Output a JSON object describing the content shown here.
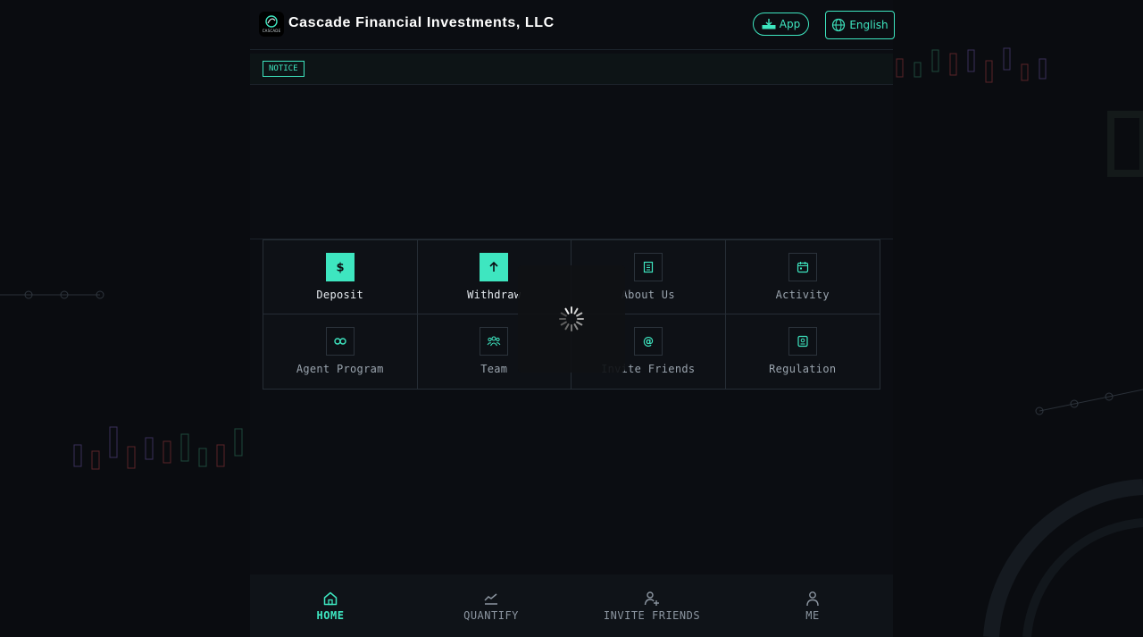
{
  "header": {
    "logo_text": "CASCADE",
    "brand": "Cascade Financial Investments, LLC",
    "app_button": "App",
    "language_button": "English"
  },
  "notice": {
    "tag": "NOTICE"
  },
  "quick_actions": [
    {
      "label": "Deposit",
      "icon": "dollar-icon"
    },
    {
      "label": "Withdraw",
      "icon": "arrow-up-icon"
    },
    {
      "label": "About Us",
      "icon": "document-icon"
    },
    {
      "label": "Activity",
      "icon": "calendar-icon"
    },
    {
      "label": "Agent Program",
      "icon": "infinity-icon"
    },
    {
      "label": "Team",
      "icon": "team-icon"
    },
    {
      "label": "Invite Friends",
      "icon": "at-sign-icon"
    },
    {
      "label": "Regulation",
      "icon": "certificate-icon"
    }
  ],
  "tabbar": [
    {
      "label": "HOME",
      "icon": "home-icon",
      "active": true
    },
    {
      "label": "QUANTIFY",
      "icon": "chart-icon",
      "active": false
    },
    {
      "label": "INVITE FRIENDS",
      "icon": "user-plus-icon",
      "active": false
    },
    {
      "label": "ME",
      "icon": "user-icon",
      "active": false
    }
  ],
  "colors": {
    "accent": "#3ee6c0",
    "background": "#0a0c10"
  }
}
